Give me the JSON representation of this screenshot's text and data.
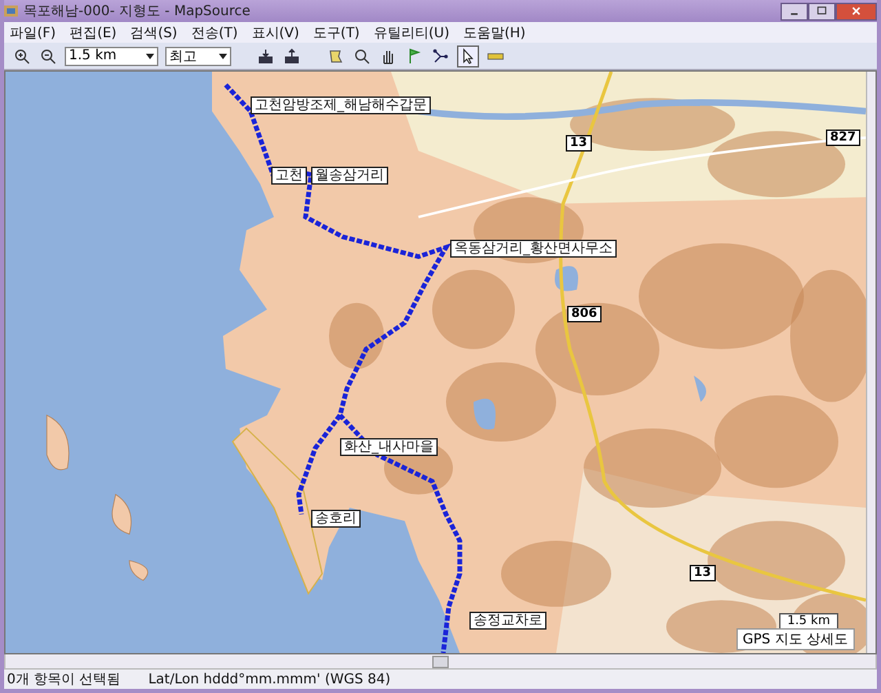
{
  "window": {
    "title": "목포해남-000- 지형도 - MapSource"
  },
  "menu": [
    "파일(F)",
    "편집(E)",
    "검색(S)",
    "전송(T)",
    "표시(V)",
    "도구(T)",
    "유틸리티(U)",
    "도움말(H)"
  ],
  "toolbar": {
    "scale_select": "1.5 km",
    "detail_select": "최고"
  },
  "map": {
    "waypoints": [
      "고천암방조제_해남해수갑문",
      "고천",
      "월송삼거리",
      "옥동삼거리_황산면사무소",
      "화산_내사마을",
      "송호리",
      "송정교차로"
    ],
    "road_numbers": [
      "13",
      "827",
      "806",
      "13"
    ],
    "scale": "1.5 km",
    "map_name": "GPS 지도 상세도"
  },
  "status_bar": {
    "selection": "0개 항목이 선택됨",
    "format": "Lat/Lon hddd°mm.mmm' (WGS 84)"
  }
}
